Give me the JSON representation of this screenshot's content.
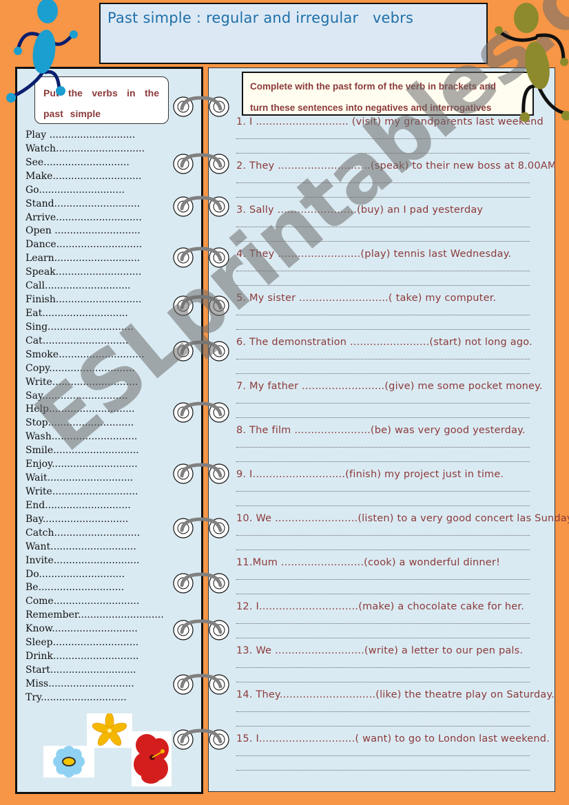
{
  "title": "Past simple : regular and irregular   vebrs",
  "left_panel": {
    "instruction": "Put the verbs in the past simple",
    "verbs": [
      {
        "word": "Play",
        "dots": " ............................"
      },
      {
        "word": "Watch",
        "dots": "............................."
      },
      {
        "word": "See",
        "dots": "............................"
      },
      {
        "word": "Make",
        "dots": "............................."
      },
      {
        "word": "Go",
        "dots": "............................"
      },
      {
        "word": "Stand",
        "dots": "............................"
      },
      {
        "word": "Arrive",
        "dots": "............................"
      },
      {
        "word": "Open",
        "dots": " ............................"
      },
      {
        "word": "Dance",
        "dots": "............................"
      },
      {
        "word": "Learn",
        "dots": "............................"
      },
      {
        "word": "Speak",
        "dots": "............................"
      },
      {
        "word": "Call",
        "dots": "............................"
      },
      {
        "word": "Finish",
        "dots": "............................"
      },
      {
        "word": "Eat",
        "dots": "............................"
      },
      {
        "word": "Sing",
        "dots": "............................"
      },
      {
        "word": "Cat",
        "dots": "............................"
      },
      {
        "word": "Smoke",
        "dots": "............................"
      },
      {
        "word": "Copy",
        "dots": "............................"
      },
      {
        "word": "Write",
        "dots": "............................"
      },
      {
        "word": "Say",
        "dots": "............................"
      },
      {
        "word": "Help",
        "dots": "............................"
      },
      {
        "word": "Stop",
        "dots": "............................"
      },
      {
        "word": "Wash",
        "dots": "............................"
      },
      {
        "word": "Smile",
        "dots": "............................"
      },
      {
        "word": "Enjoy",
        "dots": "............................"
      },
      {
        "word": "Wait",
        "dots": "............................"
      },
      {
        "word": "Write",
        "dots": "............................"
      },
      {
        "word": "End",
        "dots": "............................"
      },
      {
        "word": "Bay",
        "dots": "............................"
      },
      {
        "word": "Catch",
        "dots": "............................"
      },
      {
        "word": "Want",
        "dots": "............................"
      },
      {
        "word": "Invite",
        "dots": "............................"
      },
      {
        "word": "Do",
        "dots": "............................"
      },
      {
        "word": "Be",
        "dots": "............................"
      },
      {
        "word": "Come",
        "dots": "............................"
      },
      {
        "word": "Remember",
        "dots": "............................"
      },
      {
        "word": "Know",
        "dots": "............................"
      },
      {
        "word": "Sleep",
        "dots": "............................"
      },
      {
        "word": "Drink",
        "dots": "............................"
      },
      {
        "word": "Start",
        "dots": "............................"
      },
      {
        "word": "Miss",
        "dots": "............................"
      },
      {
        "word": "Try",
        "dots": "............................"
      }
    ]
  },
  "right_panel": {
    "instruction_line1": "Complete with the past form of the verb in brackets and",
    "instruction_line2": "turn these sentences into negatives and interrogatives",
    "sentences": [
      "1. I ............................ (visit) my grandparents last weekend",
      "2. They ............................(speak) to their new boss at 8.00AM",
      "3. Sally ........................(buy) an I pad yesterday",
      "4. They .........................(play) tennis last Wednesday.",
      "5. My sister ...........................( take) my computer.",
      "6. The demonstration ........................(start) not long ago.",
      "7. My father .........................(give) me some pocket money.",
      "8. The film .......................(be) was very good yesterday.",
      "9. I............................(finish) my project just in time.",
      "10. We .........................(listen) to a very good concert las Sunday.",
      "11.Mum .........................(cook) a wonderful dinner!",
      "12. I..............................(make)  a chocolate cake for her.",
      "13. We ...........................(write) a letter to our pen pals.",
      "14. They.............................(like) the theatre play on Saturday.",
      "15. I.............................( want) to go to London last weekend."
    ]
  },
  "watermark": "ESLprintables.com",
  "colors": {
    "background": "#f79646",
    "panel": "#daeaf2",
    "title_text": "#1f6fa8",
    "exercise_text": "#8b3a3a"
  },
  "decorations": {
    "left_figure": "blue-running-figure",
    "right_figure": "olive-running-figure",
    "flowers": [
      "yellow-flower",
      "blue-flower",
      "red-hibiscus"
    ]
  }
}
